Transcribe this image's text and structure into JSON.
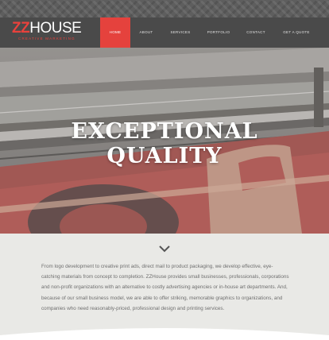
{
  "logo": {
    "zz": "ZZ",
    "house": "HOUSE",
    "tagline": "CREATIVE MARKETING"
  },
  "nav": {
    "items": [
      {
        "label": "HOME",
        "active": true
      },
      {
        "label": "ABOUT",
        "active": false
      },
      {
        "label": "SERVICES",
        "active": false
      },
      {
        "label": "PORTFOLIO",
        "active": false
      },
      {
        "label": "CONTACT",
        "active": false
      },
      {
        "label": "GET A QUOTE",
        "active": false
      }
    ]
  },
  "hero": {
    "line1": "EXCEPTIONAL",
    "line2": "QUALITY"
  },
  "icons": {
    "scroll": "chevron-down-icon"
  },
  "intro": {
    "text": "From logo development to creative print ads, direct mail to product packaging, we develop effective, eye-catching materials from concept to completion. ZZHouse provides small businesses, professionals, corporations and non-profit organizations with an alternative to costly advertising agencies or in-house art departments. And, because of our small business model, we are able to offer striking, memorable graphics to organizations, and companies who need reasonably-priced, professional design and printing services."
  },
  "colors": {
    "accent": "#e5423d",
    "header": "#4a4a4a",
    "page": "#e9e9e6"
  }
}
